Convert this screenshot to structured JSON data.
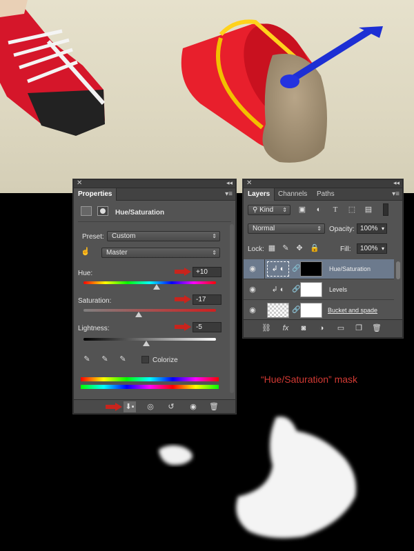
{
  "properties_panel": {
    "tab": "Properties",
    "adjustment_title": "Hue/Saturation",
    "preset_label": "Preset:",
    "preset_value": "Custom",
    "channel_value": "Master",
    "hue_label": "Hue:",
    "hue_value": "+10",
    "saturation_label": "Saturation:",
    "saturation_value": "-17",
    "lightness_label": "Lightness:",
    "lightness_value": "-5",
    "colorize_label": "Colorize"
  },
  "layers_panel": {
    "tabs": [
      "Layers",
      "Channels",
      "Paths"
    ],
    "filter_kind": "Kind",
    "blend_mode": "Normal",
    "opacity_label": "Opacity:",
    "opacity_value": "100%",
    "lock_label": "Lock:",
    "fill_label": "Fill:",
    "fill_value": "100%",
    "layers": [
      {
        "name": "Hue/Saturation",
        "selected": true
      },
      {
        "name": "Levels",
        "selected": false
      },
      {
        "name": "Bucket and spade",
        "selected": false
      }
    ]
  },
  "annotation": {
    "mask_caption": "“Hue/Saturation” mask"
  },
  "colors": {
    "panel_bg": "#535353",
    "selected_layer": "#6c7a8d",
    "annotation_red": "#d33a34"
  }
}
